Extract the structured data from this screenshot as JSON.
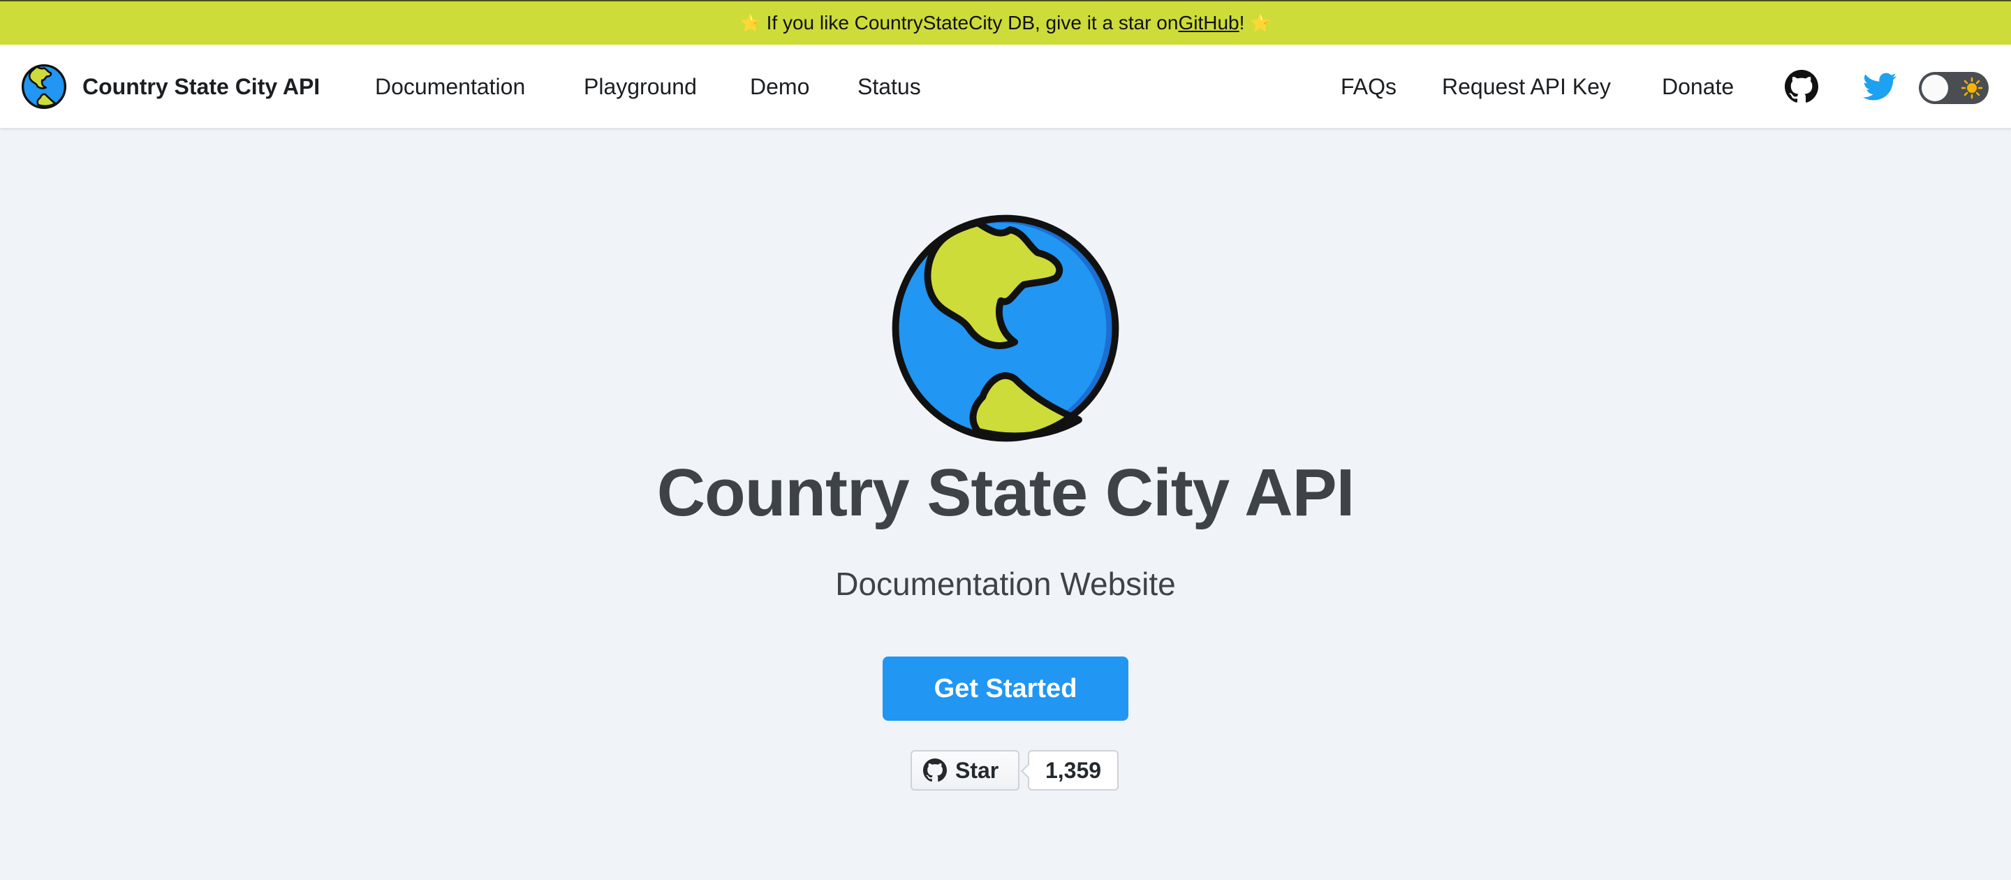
{
  "announcement": {
    "prefix": "If you like CountryStateCity DB, give it a star on ",
    "link_text": "GitHub",
    "suffix": "!",
    "star_icon": "star-icon",
    "bg_color": "#cddc39"
  },
  "navbar": {
    "brand_title": "Country State City API",
    "brand_icon": "globe-icon",
    "left_links": [
      "Documentation",
      "Playground",
      "Demo",
      "Status"
    ],
    "right_links": [
      "FAQs",
      "Request API Key",
      "Donate"
    ],
    "icons": [
      "github-icon",
      "twitter-icon"
    ],
    "theme_toggle": {
      "state": "light",
      "icon": "sun-icon"
    }
  },
  "hero": {
    "title": "Country State City API",
    "subtitle": "Documentation Website",
    "cta_label": "Get Started",
    "cta_color": "#2196f3"
  },
  "github_button": {
    "label": "Star",
    "count": "1,359",
    "icon": "github-icon"
  }
}
